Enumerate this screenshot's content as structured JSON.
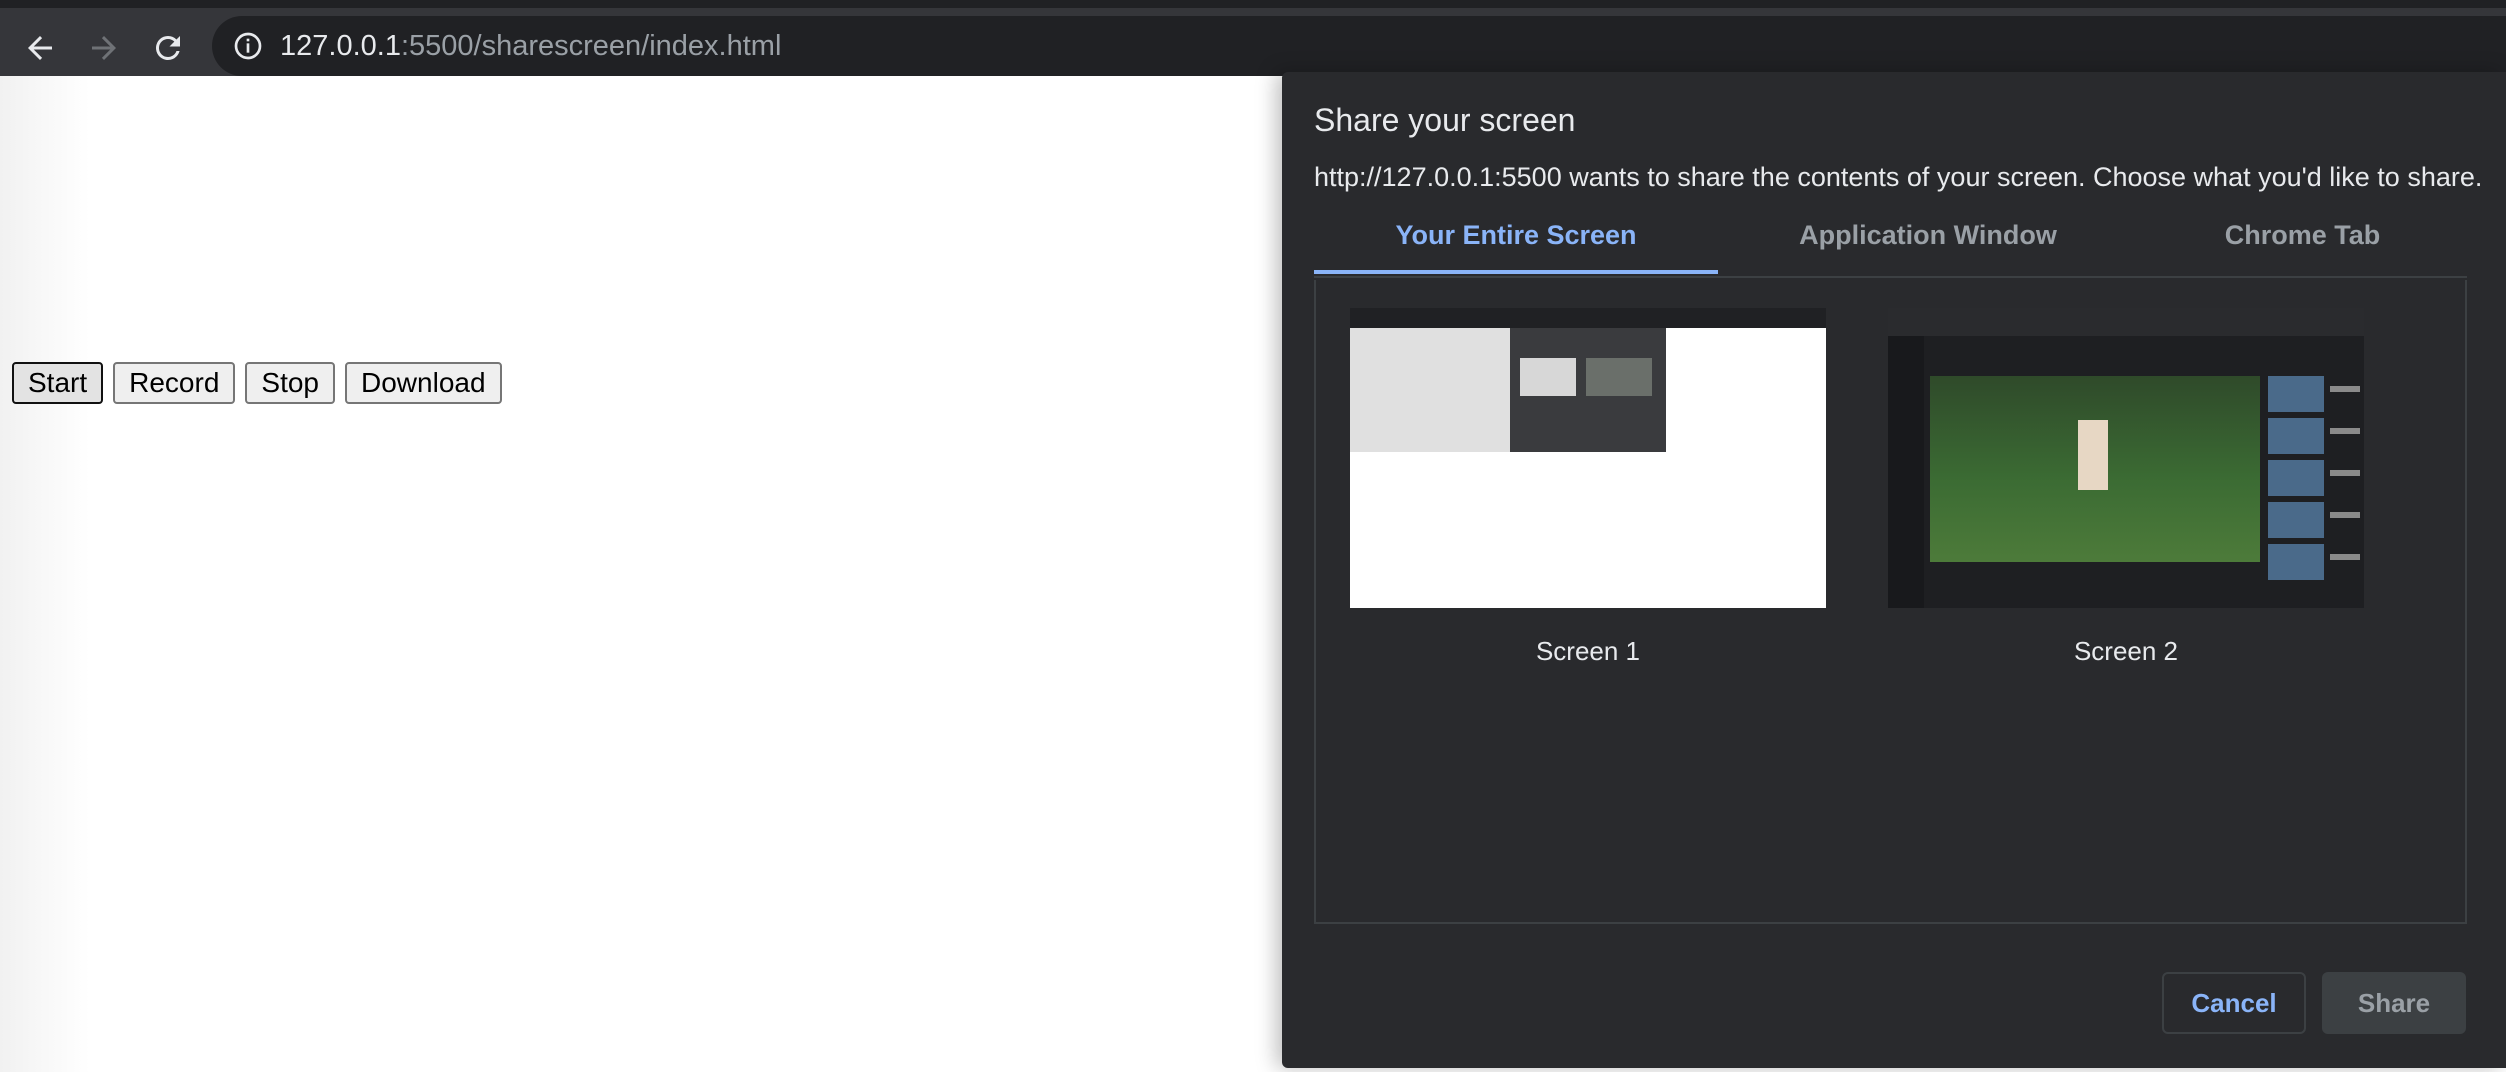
{
  "browser": {
    "url_host": "127.0.0.1",
    "url_path": ":5500/sharescreen/index.html"
  },
  "page": {
    "buttons": [
      "Start",
      "Record",
      "Stop",
      "Download"
    ]
  },
  "dialog": {
    "title": "Share your screen",
    "subtitle": "http://127.0.0.1:5500 wants to share the contents of your screen. Choose what you'd like to share.",
    "tabs": [
      "Your Entire Screen",
      "Application Window",
      "Chrome Tab"
    ],
    "active_tab": "Your Entire Screen",
    "screens": [
      "Screen 1",
      "Screen 2"
    ],
    "cancel_label": "Cancel",
    "share_label": "Share"
  },
  "colors": {
    "toolbar": "#35363a",
    "dialog_bg": "#292a2d",
    "accent": "#8ab4f8"
  }
}
